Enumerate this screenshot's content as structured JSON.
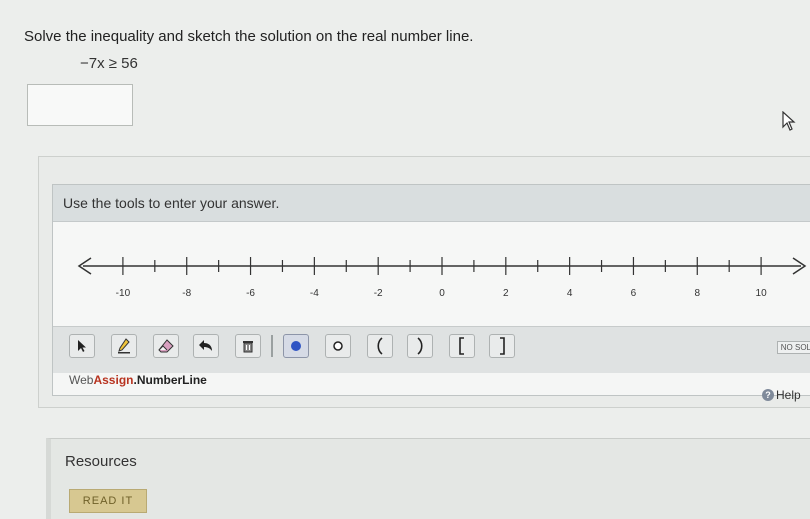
{
  "question": {
    "prompt": "Solve the inequality and sketch the solution on the real number line.",
    "expression": "−7x ≥ 56"
  },
  "answer_input": {
    "value": ""
  },
  "tool": {
    "header": "Use the tools to enter your answer.",
    "number_line": {
      "min": -11,
      "max": 11,
      "labeled_ticks": [
        "-10",
        "-8",
        "-6",
        "-4",
        "-2",
        "0",
        "2",
        "4",
        "6",
        "8",
        "10"
      ],
      "labeled_values": [
        -10,
        -8,
        -6,
        -4,
        -2,
        0,
        2,
        4,
        6,
        8,
        10
      ]
    },
    "toolbar": {
      "icons": [
        "pointer-icon",
        "pencil-icon",
        "eraser-icon",
        "undo-icon",
        "trash-icon",
        "closed-dot-icon",
        "open-dot-icon",
        "left-paren-icon",
        "right-paren-icon",
        "left-bracket-icon",
        "right-bracket-icon"
      ],
      "no_solution": "NO SOL"
    },
    "brand": {
      "web": "Web",
      "assign": "Assign",
      "product": ".NumberLine"
    },
    "help": "Help"
  },
  "resources": {
    "title": "Resources",
    "read_button": "READ IT"
  },
  "colors": {
    "accent_dot": "#2f54c4",
    "brand_red": "#b8331f",
    "read_button": "#d7c891"
  }
}
